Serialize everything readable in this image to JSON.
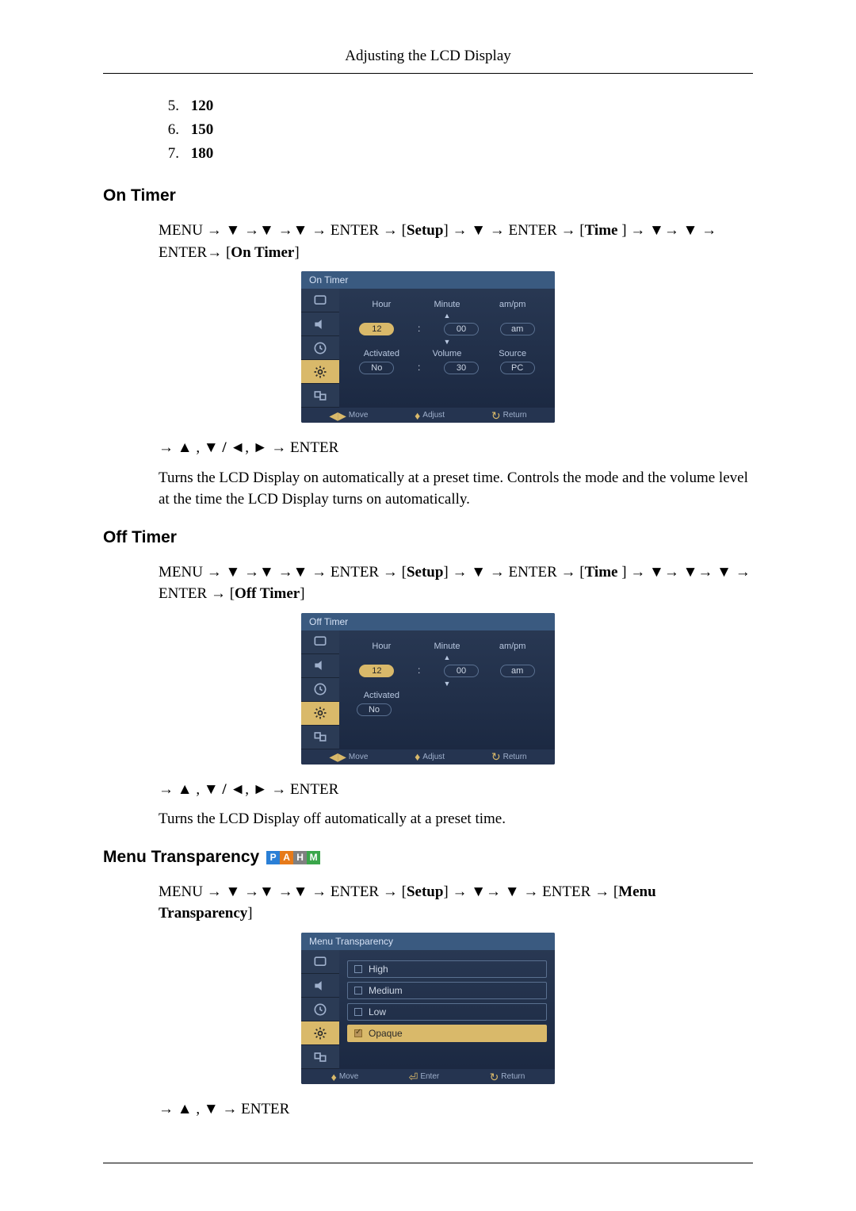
{
  "header": {
    "title": "Adjusting the LCD Display"
  },
  "num_list": [
    {
      "num": "5.",
      "val": "120"
    },
    {
      "num": "6.",
      "val": "150"
    },
    {
      "num": "7.",
      "val": "180"
    }
  ],
  "sections": {
    "on_timer": {
      "heading": "On Timer",
      "nav": {
        "menu": "MENU",
        "enter": "ENTER",
        "setup": "Setup",
        "time": "Time ",
        "target": "On Timer"
      },
      "osd": {
        "title": "On Timer",
        "labels": {
          "hour": "Hour",
          "minute": "Minute",
          "ampm": "am/pm",
          "activated": "Activated",
          "volume": "Volume",
          "source": "Source"
        },
        "values": {
          "hour": "12",
          "minute": "00",
          "ampm": "am",
          "activated": "No",
          "volume": "30",
          "source": "PC"
        },
        "footer": {
          "move": "Move",
          "adjust": "Adjust",
          "return": "Return"
        }
      },
      "post_nav": "ENTER",
      "description": "Turns the LCD Display on automatically at a preset time. Controls the mode and the volume level at the time the LCD Display turns on automatically."
    },
    "off_timer": {
      "heading": "Off Timer",
      "nav": {
        "menu": "MENU",
        "enter": "ENTER",
        "setup": "Setup",
        "time": "Time ",
        "target": "Off Timer"
      },
      "osd": {
        "title": "Off Timer",
        "labels": {
          "hour": "Hour",
          "minute": "Minute",
          "ampm": "am/pm",
          "activated": "Activated"
        },
        "values": {
          "hour": "12",
          "minute": "00",
          "ampm": "am",
          "activated": "No"
        },
        "footer": {
          "move": "Move",
          "adjust": "Adjust",
          "return": "Return"
        }
      },
      "post_nav": "ENTER",
      "description": "Turns the LCD Display off automatically at a preset time."
    },
    "menu_transparency": {
      "heading": "Menu Transparency",
      "badges": [
        "P",
        "A",
        "H",
        "M"
      ],
      "nav": {
        "menu": "MENU",
        "enter": "ENTER",
        "setup": "Setup",
        "target": "Menu Transparency"
      },
      "osd": {
        "title": "Menu Transparency",
        "options": [
          "High",
          "Medium",
          "Low",
          "Opaque"
        ],
        "selected_index": 3,
        "footer": {
          "move": "Move",
          "enter": "Enter",
          "return": "Return"
        }
      },
      "post_nav": "ENTER"
    }
  },
  "glyphs": {
    "down": "▼",
    "up": "▲",
    "left": "◄",
    "right": "►",
    "arrow": "→",
    "slash": "/",
    "comma": ","
  }
}
